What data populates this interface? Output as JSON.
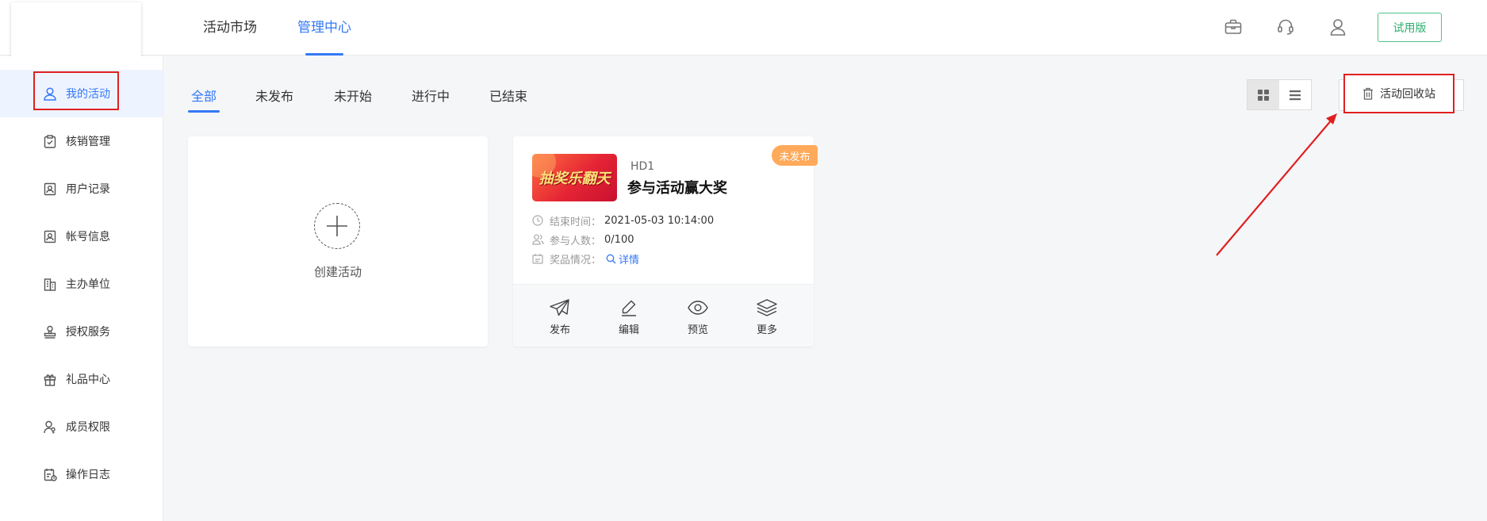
{
  "header": {
    "nav": [
      {
        "label": "活动市场",
        "active": false
      },
      {
        "label": "管理中心",
        "active": true
      }
    ],
    "icons": [
      "briefcase-icon",
      "headset-icon",
      "user-icon"
    ],
    "trial_label": "试用版"
  },
  "sidebar": {
    "items": [
      {
        "label": "我的活动",
        "icon": "user-icon",
        "active": true
      },
      {
        "label": "核销管理",
        "icon": "clipboard-check-icon",
        "active": false
      },
      {
        "label": "用户记录",
        "icon": "id-card-icon",
        "active": false
      },
      {
        "label": "帐号信息",
        "icon": "account-card-icon",
        "active": false
      },
      {
        "label": "主办单位",
        "icon": "building-icon",
        "active": false
      },
      {
        "label": "授权服务",
        "icon": "stamp-icon",
        "active": false
      },
      {
        "label": "礼品中心",
        "icon": "gift-icon",
        "active": false
      },
      {
        "label": "成员权限",
        "icon": "user-key-icon",
        "active": false
      },
      {
        "label": "操作日志",
        "icon": "calendar-log-icon",
        "active": false
      }
    ]
  },
  "tabs": [
    {
      "label": "全部",
      "active": true
    },
    {
      "label": "未发布",
      "active": false
    },
    {
      "label": "未开始",
      "active": false
    },
    {
      "label": "进行中",
      "active": false
    },
    {
      "label": "已结束",
      "active": false
    }
  ],
  "toolbar": {
    "view_modes": [
      "grid-view-icon",
      "list-view-icon"
    ],
    "active_view": "grid",
    "recycle_label": "活动回收站"
  },
  "create_card": {
    "label": "创建活动"
  },
  "activity_card": {
    "thumbnail_text": "抽奖乐翻天",
    "code": "HD1",
    "title": "参与活动赢大奖",
    "status_badge": "未发布",
    "end_time_label": "结束时间：",
    "end_time_value": "2021-05-03 10:14:00",
    "participants_label": "参与人数：",
    "participants_value": "0/100",
    "prize_label": "奖品情况：",
    "prize_link": "详情",
    "actions": [
      {
        "label": "发布",
        "icon": "send-icon"
      },
      {
        "label": "编辑",
        "icon": "edit-icon"
      },
      {
        "label": "预览",
        "icon": "eye-icon"
      },
      {
        "label": "更多",
        "icon": "layers-icon"
      }
    ]
  },
  "colors": {
    "accent": "#3478f6",
    "highlight_box": "#e02020",
    "trial_green": "#2fae6f",
    "badge_orange": "#ffa95a"
  }
}
